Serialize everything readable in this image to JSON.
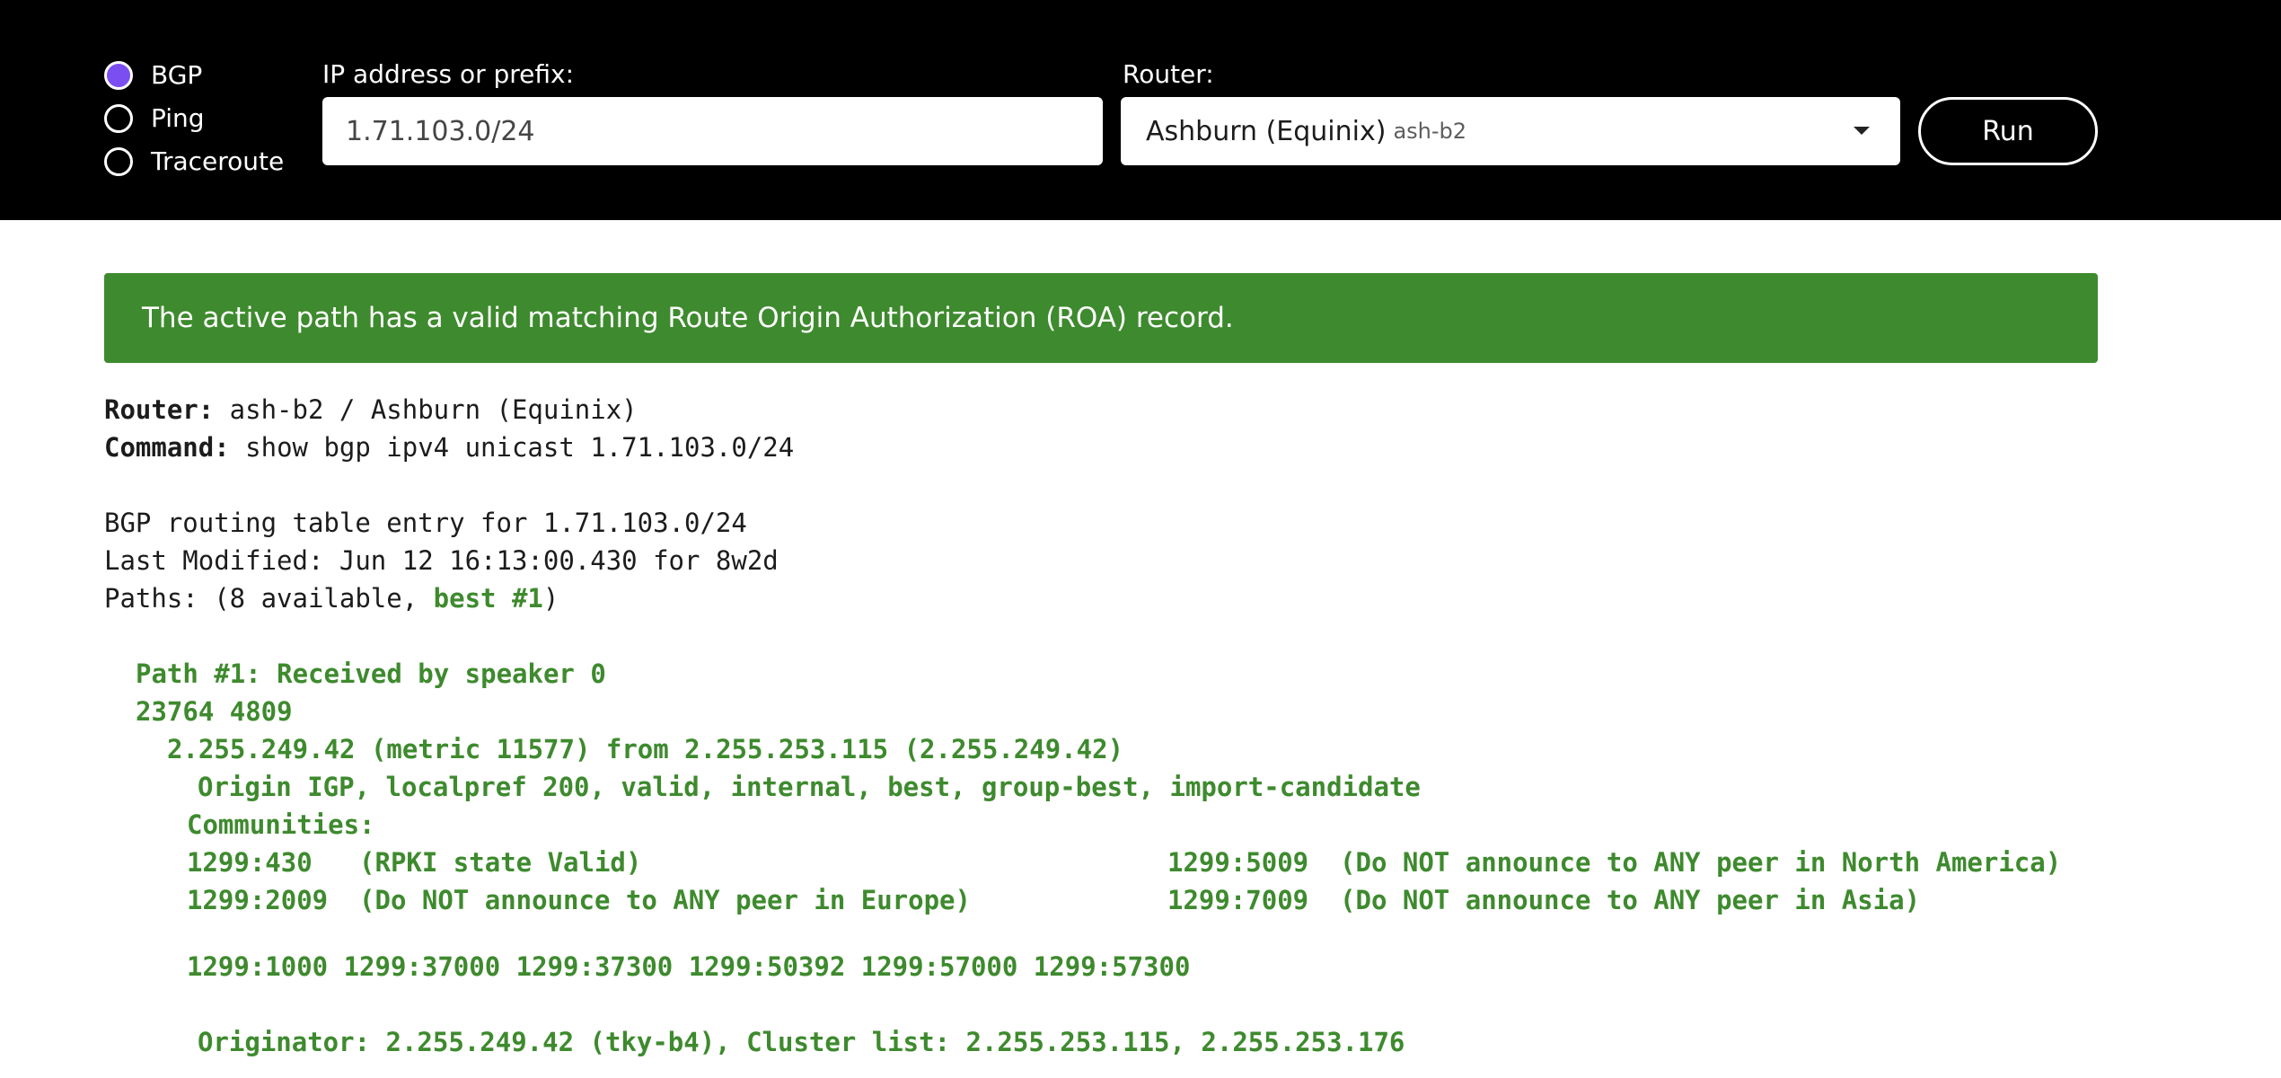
{
  "query_types": [
    {
      "label": "BGP",
      "checked": true
    },
    {
      "label": "Ping",
      "checked": false
    },
    {
      "label": "Traceroute",
      "checked": false
    }
  ],
  "ip_field": {
    "label": "IP address or prefix:",
    "value": "1.71.103.0/24"
  },
  "router_field": {
    "label": "Router:",
    "selected_name": "Ashburn (Equinix)",
    "selected_code": "ash-b2"
  },
  "run_label": "Run",
  "banner": {
    "text": "The active path has a valid matching Route Origin Authorization (ROA) record.",
    "color": "#3e8a2e"
  },
  "output": {
    "router_key": "Router:",
    "router_val": " ash-b2 / Ashburn (Equinix)",
    "command_key": "Command:",
    "command_val": " show bgp ipv4 unicast 1.71.103.0/24",
    "entry": "BGP routing table entry for 1.71.103.0/24",
    "last_modified": "Last Modified: Jun 12 16:13:00.430 for 8w2d",
    "paths_prefix": "Paths: (8 available, ",
    "paths_best": "best #1",
    "paths_suffix": ")",
    "path_header": "Path #1: Received by speaker 0",
    "as_path": "23764 4809",
    "nexthop": "2.255.249.42 (metric 11577) from 2.255.253.115 (2.255.249.42)",
    "origin": "Origin IGP, localpref 200, valid, internal, best, group-best, import-candidate",
    "communities_label": "Communities:",
    "community_rows": [
      [
        "1299:430   (RPKI state Valid)",
        "1299:5009  (Do NOT announce to ANY peer in North America)"
      ],
      [
        "1299:2009  (Do NOT announce to ANY peer in Europe)",
        "1299:7009  (Do NOT announce to ANY peer in Asia)"
      ]
    ],
    "community_list": "1299:1000 1299:37000 1299:37300 1299:50392 1299:57000 1299:57300",
    "originator": "Originator: 2.255.249.42 (tky-b4), Cluster list: 2.255.253.115, 2.255.253.176"
  }
}
